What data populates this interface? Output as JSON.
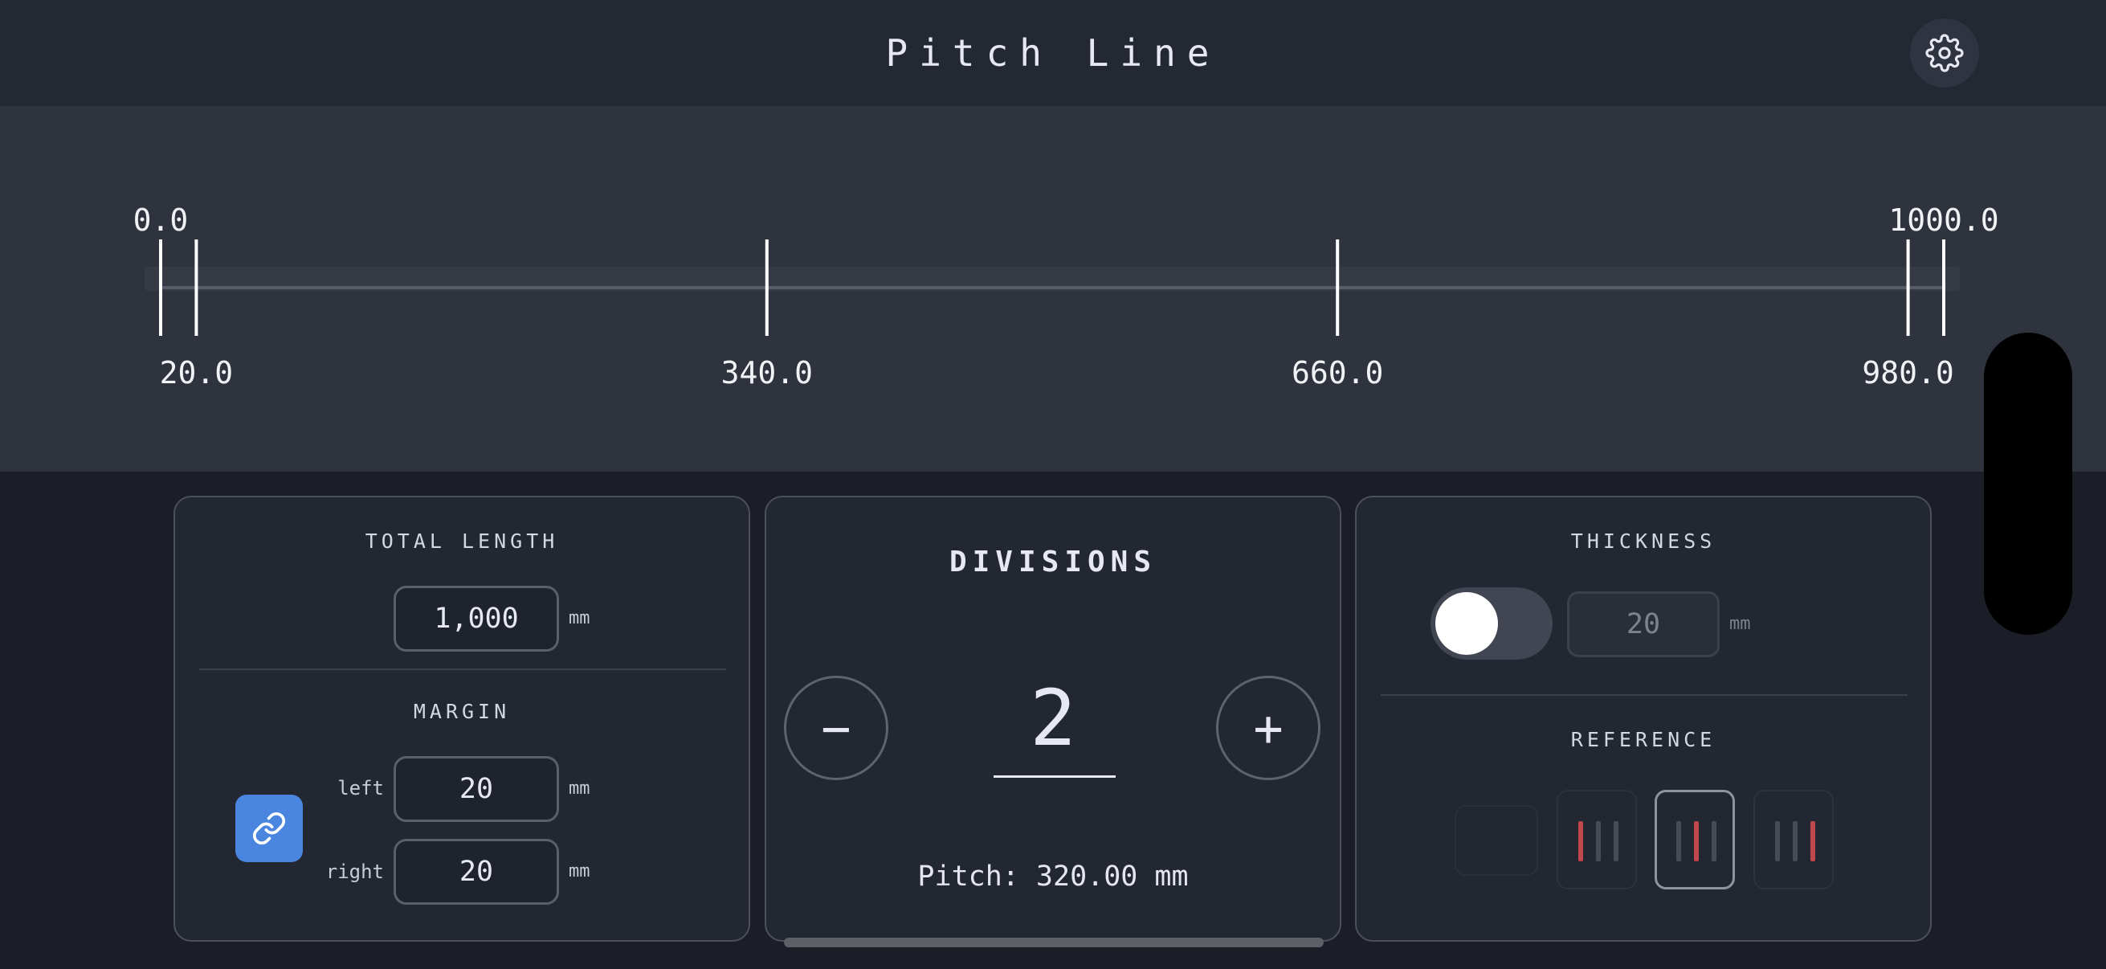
{
  "header": {
    "title": "Pitch Line",
    "settings_icon": "gear-icon"
  },
  "ruler": {
    "total_mm": 1000,
    "start_label": "0.0",
    "end_label": "1000.0",
    "marks": [
      {
        "position_mm": 20,
        "label": "20.0"
      },
      {
        "position_mm": 340,
        "label": "340.0"
      },
      {
        "position_mm": 660,
        "label": "660.0"
      },
      {
        "position_mm": 980,
        "label": "980.0"
      }
    ]
  },
  "length_card": {
    "title": "TOTAL LENGTH",
    "total_value": "1,000",
    "unit": "mm",
    "margin_title": "MARGIN",
    "left_label": "left",
    "left_value": "20",
    "right_label": "right",
    "right_value": "20",
    "link_icon": "link-icon",
    "link_color": "#4a86e0"
  },
  "divisions_card": {
    "title": "DIVISIONS",
    "value": "2",
    "minus": "−",
    "plus": "+",
    "pitch_text": "Pitch: 320.00 mm"
  },
  "thickness_card": {
    "title": "THICKNESS",
    "toggle_on": false,
    "value": "20",
    "unit": "mm",
    "reference_title": "REFERENCE",
    "reference_options": [
      "none",
      "left",
      "center",
      "right"
    ],
    "reference_selected": "center",
    "accent_color": "#c0474b"
  }
}
